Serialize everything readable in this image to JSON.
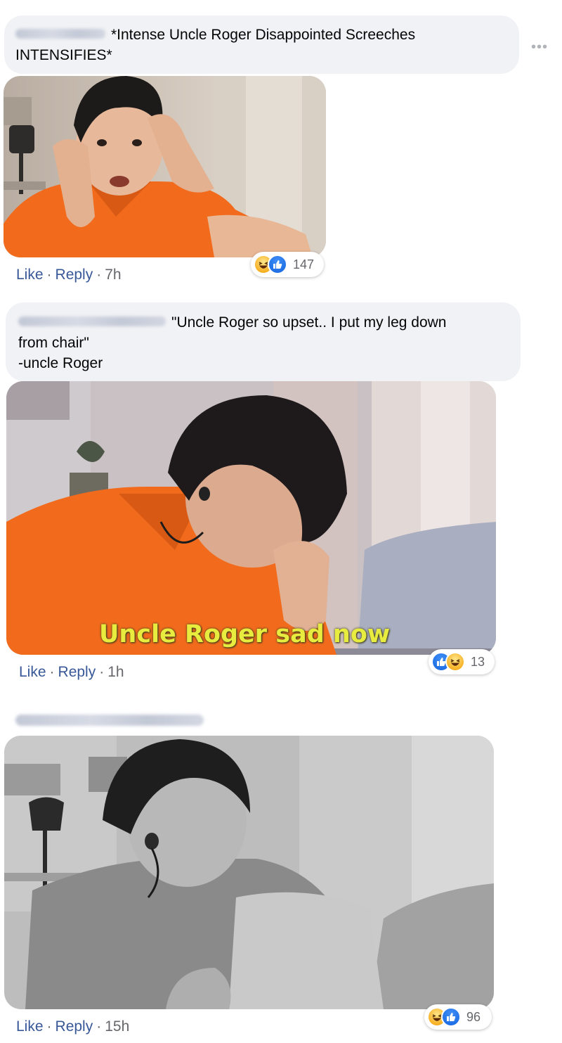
{
  "comments": [
    {
      "text": "*Intense Uncle Roger Disappointed Screeches INTENSIFIES*",
      "actions": {
        "like": "Like",
        "reply": "Reply",
        "time": "7h"
      },
      "reactions": {
        "icons": [
          "haha",
          "like"
        ],
        "count": "147"
      }
    },
    {
      "text_lines": [
        "\"Uncle Roger so upset.. I put my leg down",
        "from chair\"",
        "-uncle Roger"
      ],
      "gif_caption": "Uncle Roger sad now",
      "actions": {
        "like": "Like",
        "reply": "Reply",
        "time": "1h"
      },
      "reactions": {
        "icons": [
          "like",
          "haha"
        ],
        "count": "13"
      }
    },
    {
      "actions": {
        "like": "Like",
        "reply": "Reply",
        "time": "15h"
      },
      "reactions": {
        "icons": [
          "haha",
          "like"
        ],
        "count": "96"
      }
    }
  ],
  "separator": "·",
  "more_icon": "ellipsis-icon",
  "colors": {
    "bubble": "#f0f2f5",
    "link": "#385898",
    "meta": "#65676b",
    "shirt_orange": "#f26b1d",
    "caption_yellow": "#e7ec3f"
  }
}
